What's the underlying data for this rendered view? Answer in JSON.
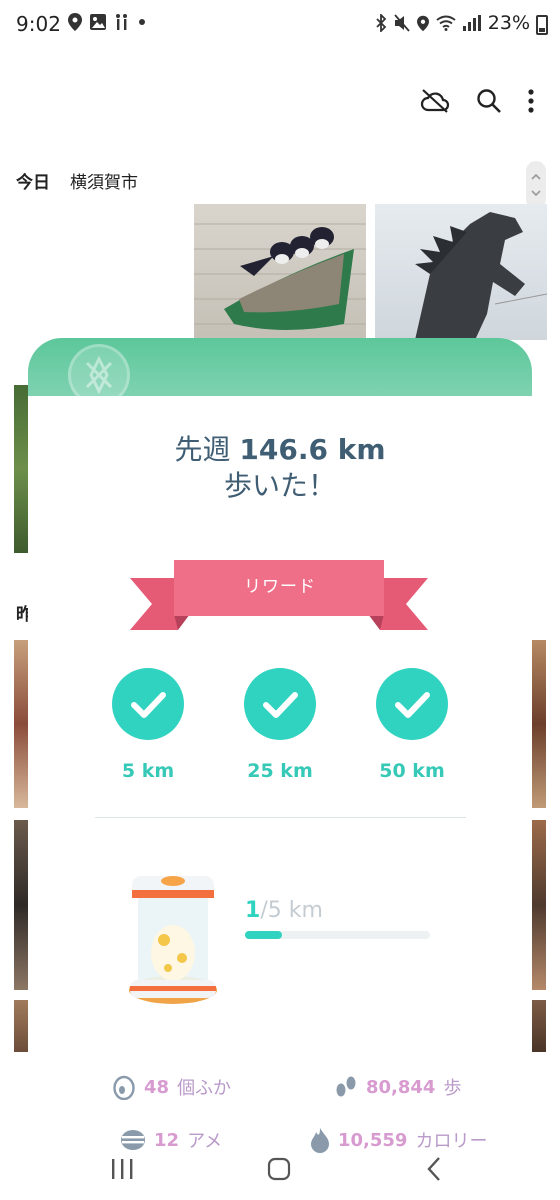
{
  "status_bar": {
    "time": "9:02",
    "battery": "23%",
    "left_icons": [
      "location-pin-icon",
      "gallery-icon",
      "walking-people-icon",
      "dot-icon"
    ],
    "right_icons": [
      "bluetooth-icon",
      "mute-icon",
      "location-icon",
      "wifi-icon",
      "signal-icon"
    ]
  },
  "toolbar": {
    "icons": [
      "cloud-off-icon",
      "search-icon",
      "more-vert-icon"
    ]
  },
  "gallery": {
    "section_today": "今日",
    "section_location": "横須賀市",
    "partial_section_label": "昨"
  },
  "card": {
    "headline_prefix": "先週",
    "headline_distance": "146.6 km",
    "headline_suffix": "歩いた！",
    "reward_label": "リワード",
    "milestones": [
      {
        "label": "5 km",
        "achieved": true
      },
      {
        "label": "25 km",
        "achieved": true
      },
      {
        "label": "50 km",
        "achieved": true
      }
    ],
    "incubator": {
      "done": "1",
      "total": "/5 km",
      "progress": 0.2
    },
    "stats": [
      {
        "icon": "egg-icon",
        "value": "48",
        "unit": "個ふか"
      },
      {
        "icon": "footsteps-icon",
        "value": "80,844",
        "unit": "歩"
      },
      {
        "icon": "candy-icon",
        "value": "12",
        "unit": "アメ"
      },
      {
        "icon": "flame-icon",
        "value": "10,559",
        "unit": "カロリー"
      }
    ]
  },
  "colors": {
    "teal": "#2fd3c0",
    "ribbon_pink": "#ee6f87",
    "headline_blue": "#3f5e73",
    "card_header_green": "#5cc79a",
    "stat_pink": "#d79bd0"
  },
  "nav": {
    "icons": [
      "recent-apps-icon",
      "home-icon",
      "back-icon"
    ]
  }
}
